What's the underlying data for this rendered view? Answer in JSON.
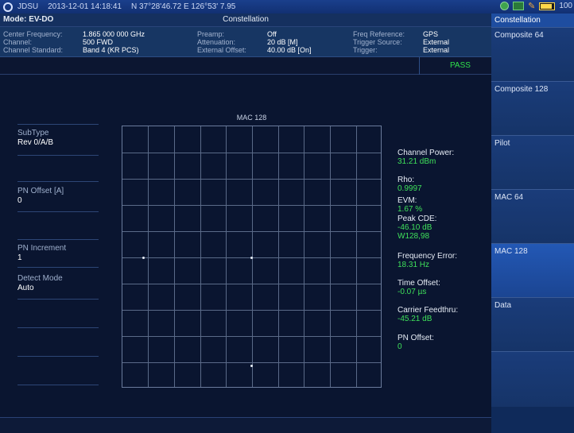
{
  "statusbar": {
    "brand": "JDSU",
    "datetime": "2013-12-01  14:18:41",
    "gps": "N 37°28'46.72 E 126°53' 7.95",
    "battery": "100"
  },
  "mode": "Mode: EV-DO",
  "screen_title": "Constellation",
  "info": {
    "col1_labels": [
      "Center Frequency:",
      "Channel:",
      "Channel Standard:"
    ],
    "col1_values": [
      "1.865 000 000 GHz",
      "500 FWD",
      "Band 4 (KR PCS)"
    ],
    "col2_labels": [
      "Preamp:",
      "Attenuation:",
      "External Offset:"
    ],
    "col2_values": [
      "Off",
      "20 dB [M]",
      "40.00 dB [On]"
    ],
    "col3_labels": [
      "Freq Reference:",
      "Trigger Source:",
      "Trigger:"
    ],
    "col3_values": [
      "GPS",
      "External",
      "External"
    ]
  },
  "status": "PASS",
  "params": [
    {
      "label": "SubType",
      "value": "Rev 0/A/B"
    },
    {
      "label": "PN Offset [A]",
      "value": "0"
    },
    {
      "label": "PN Increment",
      "value": "1"
    },
    {
      "label": "Detect Mode",
      "value": "Auto"
    }
  ],
  "plot_title": "MAC 128",
  "results": [
    {
      "label": "Channel Power:",
      "value": "31.21 dBm"
    },
    {
      "label": "Rho:",
      "value": "0.9997"
    },
    {
      "label": "EVM:",
      "value": "1.67 %"
    },
    {
      "label": "Peak CDE:",
      "value": "-46.10 dB",
      "value2": "W128,98"
    },
    {
      "label": "Frequency Error:",
      "value": "18.31 Hz"
    },
    {
      "label": "Time Offset:",
      "value": "-0.07 µs"
    },
    {
      "label": "Carrier Feedthru:",
      "value": "-45.21 dB"
    },
    {
      "label": "PN Offset:",
      "value": "0"
    }
  ],
  "menu": {
    "header": "Constellation",
    "items": [
      "Composite 64",
      "Composite 128",
      "Pilot",
      "MAC 64",
      "MAC 128",
      "Data"
    ]
  }
}
